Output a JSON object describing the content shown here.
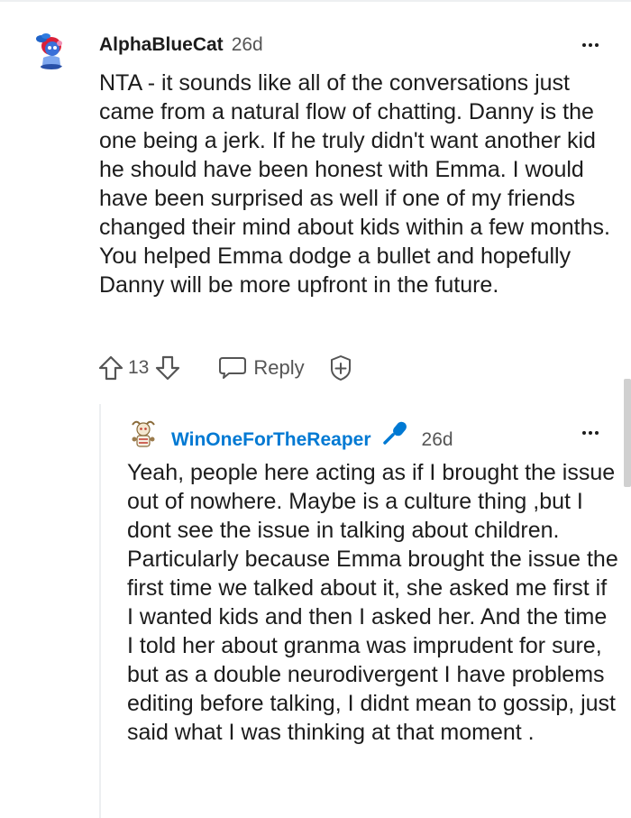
{
  "comment_1": {
    "username": "AlphaBlueCat",
    "timestamp": "26d",
    "body": "NTA - it sounds like all of the conversations just came from a natural flow of chatting. Danny is the one being a jerk. If he truly didn't want another kid he should have been honest with Emma. I would have been surprised as well if one of my friends changed their mind about kids within a few months. You helped Emma dodge a bullet and hopefully Danny will be more upfront in the future.",
    "actions": {
      "score": "13",
      "reply_label": "Reply"
    }
  },
  "comment_2": {
    "username": "WinOneForTheReaper",
    "timestamp": "26d",
    "body": "Yeah, people here acting as if I brought the issue out of nowhere. Maybe is a culture thing ,but I dont see the issue in talking about children. Particularly because Emma brought the issue the first time we talked about it, she asked me first if I wanted kids and then I asked her. And the time I told her about granma was imprudent for sure, but as a double neurodivergent I have problems editing before talking, I didnt mean to gossip, just said what I was thinking at that moment ."
  },
  "icons": {
    "upvote": "upvote-arrow-icon",
    "downvote": "downvote-arrow-icon",
    "reply": "speech-bubble-icon",
    "award": "award-plus-icon",
    "op_badge": "microphone-icon",
    "more": "ellipsis-icon"
  },
  "colors": {
    "op_username": "#0079d3",
    "text": "#1c1c1c",
    "muted": "#555555",
    "divider": "#edeff1"
  }
}
